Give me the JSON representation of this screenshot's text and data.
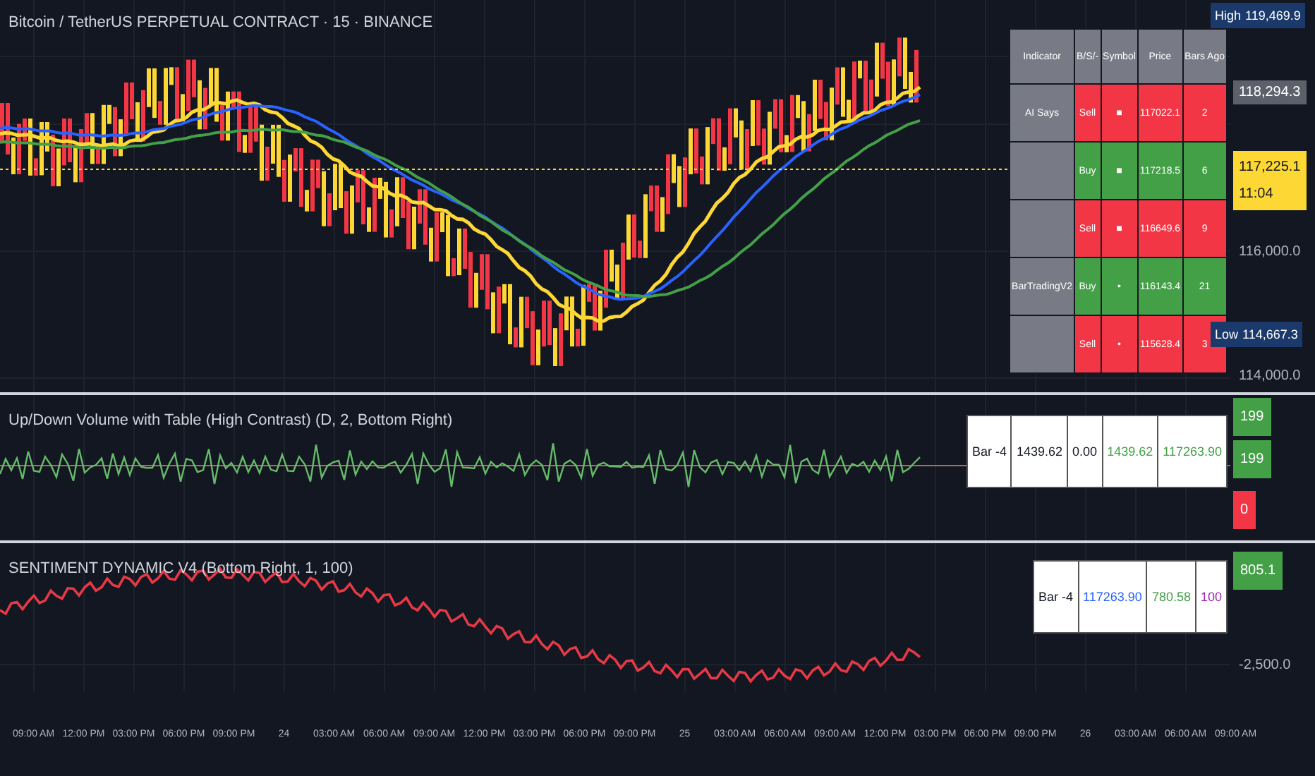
{
  "chart": {
    "legend": [
      "Bitcoin / TetherUS PERPETUAL CONTRACT · 15 · BINANCE"
    ]
  },
  "price_table": {
    "columns": [
      "Indicator",
      "B/S/-",
      "Symbol",
      "Price",
      "Bars Ago"
    ],
    "rows": [
      {
        "indicator": "AI Says",
        "signal": "Sell",
        "symbol": "■",
        "price": "117022.1",
        "bars_ago": "2",
        "color": "#f23645"
      },
      {
        "indicator": "",
        "signal": "Buy",
        "symbol": "■",
        "price": "117218.5",
        "bars_ago": "6",
        "color": "#43a047"
      },
      {
        "indicator": "",
        "signal": "Sell",
        "symbol": "■",
        "price": "116649.6",
        "bars_ago": "9",
        "color": "#f23645"
      },
      {
        "indicator": "BarTradingV2",
        "signal": "Buy",
        "symbol": "•",
        "price": "116143.4",
        "bars_ago": "21",
        "color": "#43a047"
      },
      {
        "indicator": "",
        "signal": "Sell",
        "symbol": "•",
        "price": "115628.4",
        "bars_ago": "3",
        "color": "#f23645"
      }
    ]
  },
  "price_axis": [
    {
      "label": "High",
      "value": "119,469.9",
      "kind": "high"
    },
    {
      "value": "118,294.3",
      "kind": "last"
    },
    {
      "value": "117,225.1",
      "sub": "11:04",
      "kind": "current"
    },
    {
      "value": "116,000.0",
      "kind": "plain"
    },
    {
      "label": "Low",
      "value": "114,667.3",
      "kind": "low"
    },
    {
      "value": "114,000.0",
      "kind": "plain"
    }
  ],
  "volume_pane": {
    "legend": "Up/Down Volume with Table (High Contrast) (D, 2, Bottom Right)",
    "table": [
      {
        "text": "Bar -4",
        "color": "#131722"
      },
      {
        "text": "1439.62",
        "color": "#131722"
      },
      {
        "text": "0.00",
        "color": "#131722"
      },
      {
        "text": "1439.62",
        "color": "#43a047"
      },
      {
        "text": "117263.90",
        "color": "#43a047"
      }
    ],
    "axis": [
      {
        "value": "199",
        "color": "#43a047"
      },
      {
        "value": "199",
        "color": "#43a047"
      },
      {
        "value": "0",
        "color": "#f23645"
      }
    ]
  },
  "sentiment_pane": {
    "legend": "SENTIMENT DYNAMIC V4 (Bottom Right, 1, 100)",
    "table": [
      {
        "text": "Bar -4",
        "color": "#131722"
      },
      {
        "text": "117263.90",
        "color": "#2962ff"
      },
      {
        "text": "780.58",
        "color": "#43a047"
      },
      {
        "text": "100",
        "color": "#9c27b0"
      }
    ],
    "axis": [
      {
        "value": "805.1",
        "kind": "badge"
      },
      {
        "value": "-2,500.0",
        "kind": "plain"
      }
    ]
  },
  "time_axis": [
    "09:00 AM",
    "12:00 PM",
    "03:00 PM",
    "06:00 PM",
    "09:00 PM",
    "24",
    "03:00 AM",
    "06:00 AM",
    "09:00 AM",
    "12:00 PM",
    "03:00 PM",
    "06:00 PM",
    "09:00 PM",
    "25",
    "03:00 AM",
    "06:00 AM",
    "09:00 AM",
    "12:00 PM",
    "03:00 PM",
    "06:00 PM",
    "09:00 PM",
    "26",
    "03:00 AM",
    "06:00 AM",
    "09:00 AM"
  ]
}
